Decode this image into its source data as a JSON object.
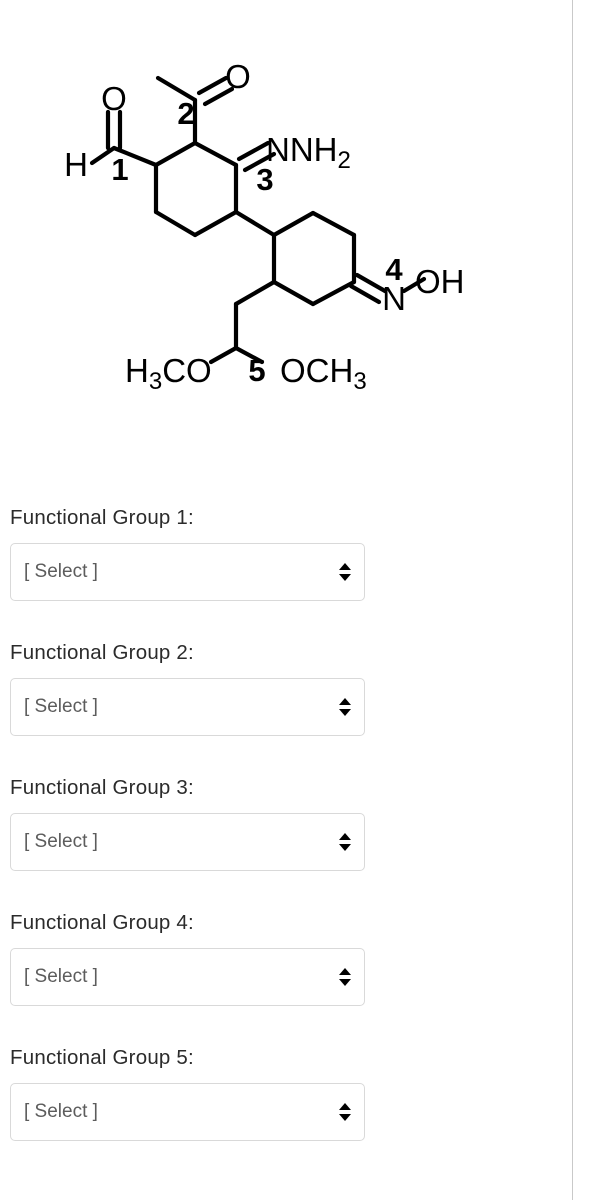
{
  "figure": {
    "name": "organic-structure-diagram",
    "description": "Line-bond structure of a bicyclohexyl compound with five numbered functional groups",
    "stroke_color": "#000000",
    "labels": {
      "aldehyde_h": "H",
      "aldehyde_o": "O",
      "marker_1": "1",
      "ketone_o": "O",
      "marker_2": "2",
      "hydrazone": "NNH",
      "hydrazone_sub": "2",
      "marker_3": "3",
      "marker_4": "4",
      "oxime_n": "N",
      "oxime_oh": "OH",
      "acetal_left": "H",
      "acetal_left_sub": "3",
      "acetal_left_rest": "CO",
      "marker_5": "5",
      "acetal_right": "OCH",
      "acetal_right_sub": "3"
    }
  },
  "form": {
    "select_placeholder": "[ Select ]",
    "groups": [
      {
        "label": "Functional Group 1:",
        "value": "[ Select ]"
      },
      {
        "label": "Functional Group 2:",
        "value": "[ Select ]"
      },
      {
        "label": "Functional Group 3:",
        "value": "[ Select ]"
      },
      {
        "label": "Functional Group 4:",
        "value": "[ Select ]"
      },
      {
        "label": "Functional Group 5:",
        "value": "[ Select ]"
      }
    ]
  },
  "colors": {
    "divider": "#c9c9c9",
    "select_border": "#d9d9d9",
    "label_text": "#2b2b2b",
    "value_text": "#5c5c5c",
    "structure_stroke": "#000000"
  }
}
